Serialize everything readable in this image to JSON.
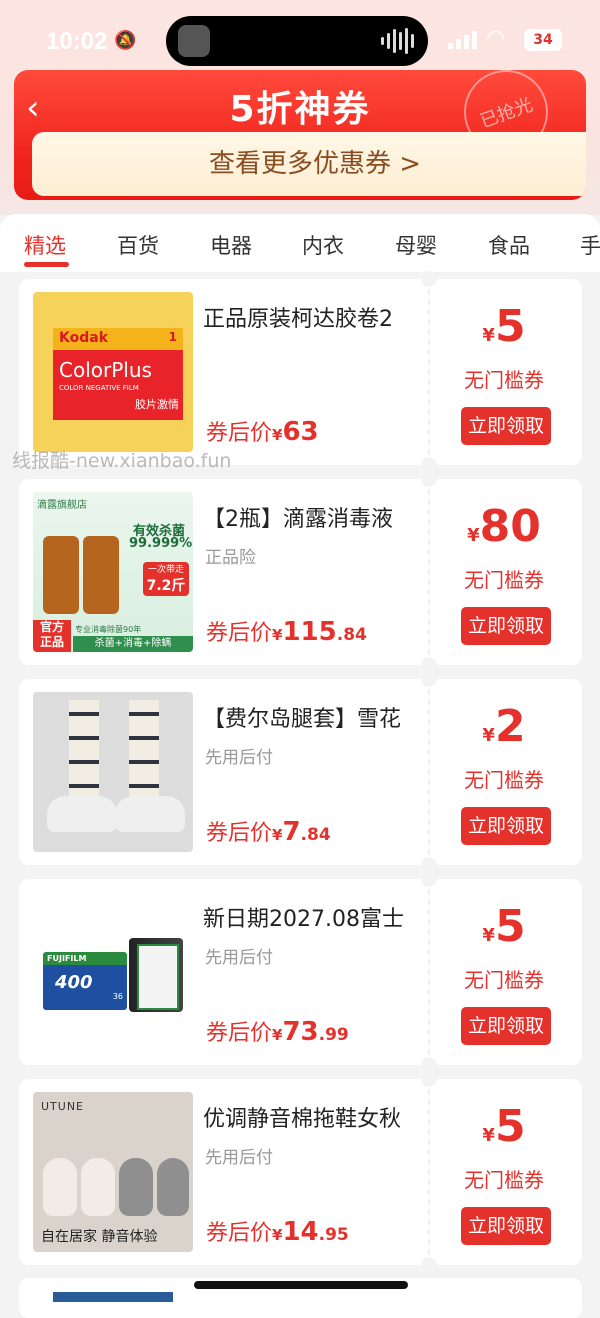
{
  "status": {
    "time": "10:02",
    "battery": "34"
  },
  "banner": {
    "title": "5折神券",
    "stamp": "已抢光",
    "more": "查看更多优惠券 >"
  },
  "tabs": [
    "精选",
    "百货",
    "电器",
    "内衣",
    "母婴",
    "食品",
    "手"
  ],
  "price_label": "券后价",
  "currency": "¥",
  "coupon_type": "无门槛券",
  "claim_label": "立即领取",
  "products": [
    {
      "title": "正品原装柯达胶卷2",
      "tag": "",
      "price_int": "63",
      "price_dec": "",
      "coupon": "5",
      "thumb": {
        "brand": "Kodak",
        "badge": "1",
        "product": "ColorPlus",
        "sub": "COLOR NEGATIVE FILM",
        "overlay": "胶片激情"
      }
    },
    {
      "title": "【2瓶】滴露消毒液",
      "tag": "正品险",
      "price_int": "115",
      "price_dec": ".84",
      "coupon": "80",
      "thumb": {
        "store": "滴露旗舰店",
        "headline1": "有效杀菌",
        "headline2": "99.999%",
        "promo1": "一次带走",
        "promo2": "7.2斤",
        "badge1": "官方",
        "badge2": "正品",
        "strip1": "专业消毒除菌90年",
        "strip2": "杀菌+消毒+除螨"
      }
    },
    {
      "title": "【费尔岛腿套】雪花",
      "tag": "先用后付",
      "price_int": "7",
      "price_dec": ".84",
      "coupon": "2"
    },
    {
      "title": "新日期2027.08富士",
      "tag": "先用后付",
      "price_int": "73",
      "price_dec": ".99",
      "coupon": "5",
      "thumb": {
        "brand": "FUJIFILM",
        "iso": "400",
        "exp": "36"
      }
    },
    {
      "title": "优调静音棉拖鞋女秋",
      "tag": "先用后付",
      "price_int": "14",
      "price_dec": ".95",
      "coupon": "5",
      "thumb": {
        "brand": "UTUNE",
        "caption": "自在居家 静音体验"
      }
    }
  ],
  "watermark": "线报酷-new.xianbao.fun",
  "colors": {
    "accent": "#e4312b",
    "banner_bg": "#f0231c",
    "more_text": "#8a4d22"
  }
}
